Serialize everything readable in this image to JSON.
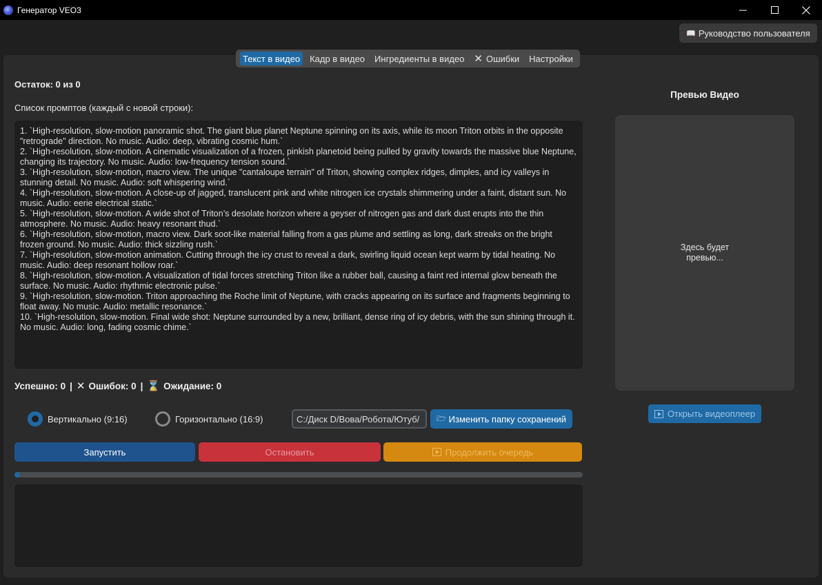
{
  "window": {
    "title": "Генератор VEO3",
    "minimize_glyph": "—",
    "close_glyph": "✕"
  },
  "manual_button": {
    "label": "Руководство пользователя",
    "icon": "book-icon"
  },
  "tabs": [
    {
      "label": "Текст в видео",
      "active": true
    },
    {
      "label": "Кадр в видео",
      "active": false
    },
    {
      "label": "Ингредиенты в видео",
      "active": false
    },
    {
      "label": "Ошибки",
      "active": false,
      "icon": "x-icon"
    },
    {
      "label": "Настройки",
      "active": false
    }
  ],
  "remaining": "Остаток: 0 из 0",
  "prompts_label": "Список промптов (каждый с новой строки):",
  "prompts": [
    "1. `High-resolution, slow-motion panoramic shot. The giant blue planet Neptune spinning on its axis, while its moon Triton orbits in the opposite \"retrograde\" direction. No music. Audio: deep, vibrating cosmic hum.`",
    "2. `High-resolution, slow-motion. A cinematic visualization of a frozen, pinkish planetoid being pulled by gravity towards the massive blue Neptune, changing its trajectory. No music. Audio: low-frequency tension sound.`",
    "3. `High-resolution, slow-motion, macro view. The unique \"cantaloupe terrain\" of Triton, showing complex ridges, dimples, and icy valleys in stunning detail. No music. Audio: soft whispering wind.`",
    "4. `High-resolution, slow-motion. A close-up of jagged, translucent pink and white nitrogen ice crystals shimmering under a faint, distant sun. No music. Audio: eerie electrical static.`",
    "5. `High-resolution, slow-motion. A wide shot of Triton’s desolate horizon where a geyser of nitrogen gas and dark dust erupts into the thin atmosphere. No music. Audio: heavy resonant thud.`",
    "6. `High-resolution, slow-motion, macro view. Dark soot-like material falling from a gas plume and settling as long, dark streaks on the bright frozen ground. No music. Audio: thick sizzling rush.`",
    "7. `High-resolution, slow-motion animation. Cutting through the icy crust to reveal a dark, swirling liquid ocean kept warm by tidal heating. No music. Audio: deep resonant hollow roar.`",
    "8. `High-resolution, slow-motion. A visualization of tidal forces stretching Triton like a rubber ball, causing a faint red internal glow beneath the surface. No music. Audio: rhythmic electronic pulse.`",
    "9. `High-resolution, slow-motion. Triton approaching the Roche limit of Neptune, with cracks appearing on its surface and fragments beginning to float away. No music. Audio: metallic resonance.`",
    "10. `High-resolution, slow-motion. Final wide shot: Neptune surrounded by a new, brilliant, dense ring of icy debris, with the sun shining through it. No music. Audio: long, fading cosmic chime.`"
  ],
  "stats": {
    "success": "Успешно: 0",
    "sep": "|",
    "errors": "Ошибок: 0",
    "waiting": "Ожидание: 0"
  },
  "orientation": {
    "vertical": "Вертикально (9:16)",
    "horizontal": "Горизонтально (16:9)",
    "selected": "vertical"
  },
  "save_path": "C:/Диск D/Вова/Робота/Ютуб/",
  "change_folder_button": {
    "label": "Изменить папку сохранений",
    "icon": "folder-icon"
  },
  "buttons": {
    "start": "Запустить",
    "stop": "Остановить",
    "continue": "Продолжить очередь"
  },
  "progress": 0.01,
  "preview": {
    "title": "Превью Видео",
    "placeholder": "Здесь будет превью...",
    "open_player": "Открыть видеоплеер"
  },
  "colors": {
    "accent": "#1f6aa5",
    "start": "#1f538d",
    "stop": "#c8323a",
    "continue": "#d68910"
  }
}
